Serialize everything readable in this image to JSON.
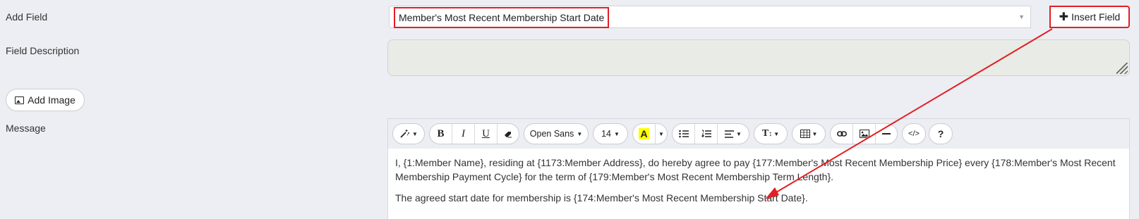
{
  "form": {
    "add_field_label": "Add Field",
    "field_description_label": "Field Description",
    "add_image_label": "Add Image",
    "message_label": "Message",
    "field_select_value": "Member's Most Recent Membership Start Date",
    "insert_field_label": "Insert Field"
  },
  "toolbar": {
    "font_name": "Open Sans",
    "font_size": "14",
    "icons": [
      "magic-wand-icon",
      "bold-icon",
      "italic-icon",
      "underline-icon",
      "eraser-icon",
      "font-color-icon",
      "unordered-list-icon",
      "ordered-list-icon",
      "align-icon",
      "text-height-icon",
      "table-icon",
      "link-icon",
      "picture-icon",
      "horizontal-rule-icon",
      "code-view-icon",
      "help-icon"
    ]
  },
  "message": {
    "paragraph_1": "I, {1:Member Name}, residing at {1173:Member Address}, do hereby agree to pay {177:Member's Most Recent Membership Price} every {178:Member's Most Recent Membership Payment Cycle} for the term of {179:Member's Most Recent Membership Term Length}.",
    "paragraph_2": "The agreed start date for membership is {174:Member's Most Recent Membership Start Date}."
  },
  "colors": {
    "highlight_red": "#e31e24",
    "page_bg": "#eceef3",
    "font_color_swatch": "#ffff00"
  }
}
